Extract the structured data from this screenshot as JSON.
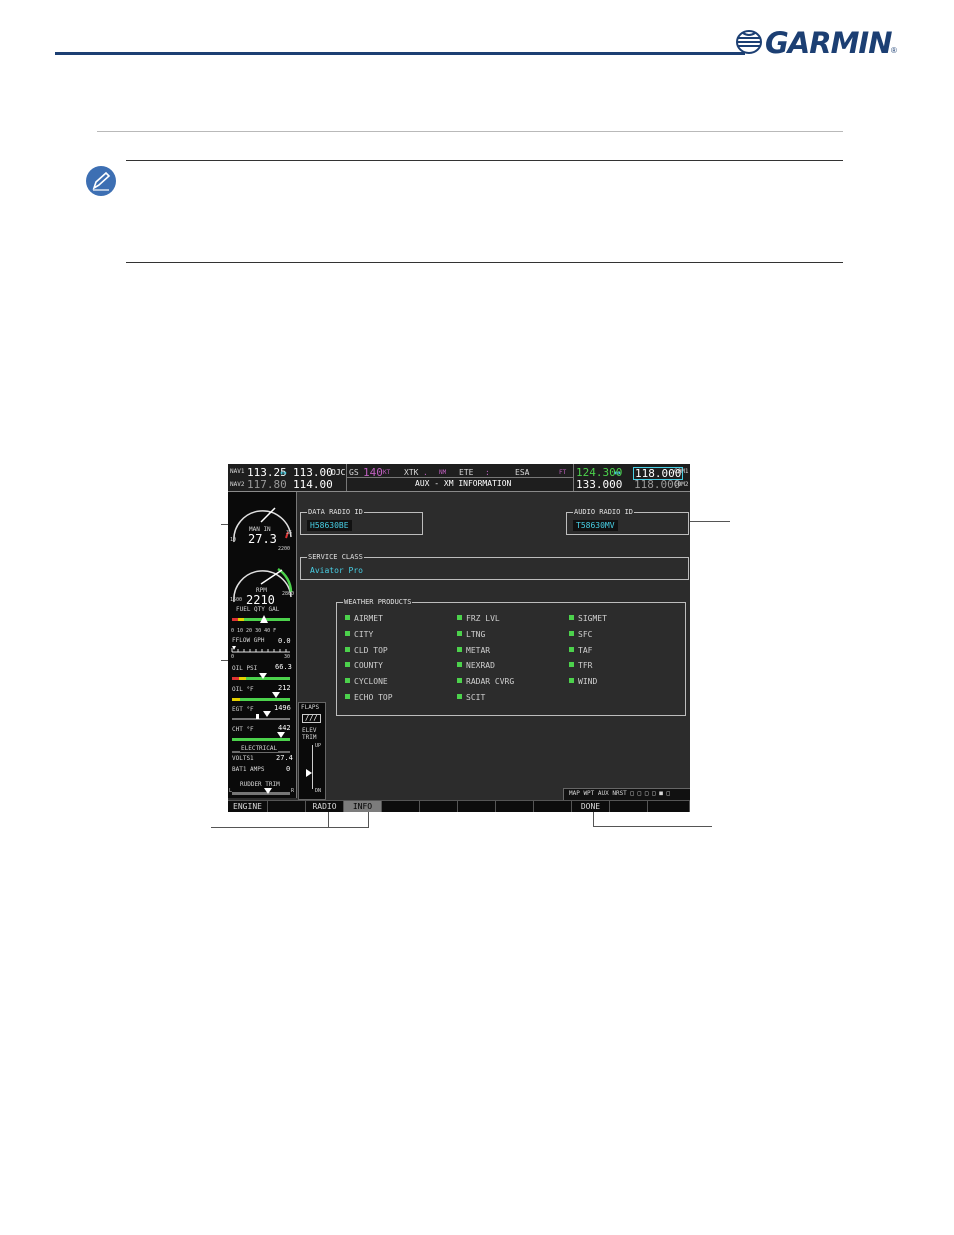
{
  "brand": {
    "name": "GARMIN",
    "reg": "®",
    "logo_icon": "globe-icon"
  },
  "note_icon": "pencil-note-icon",
  "screen": {
    "header": {
      "nav1_label": "NAV1",
      "nav1_active": "113.25",
      "nav1_swap": "↔",
      "nav1_standby": "113.00",
      "nav1_ident": "OJC",
      "nav2_label": "NAV2",
      "nav2_active": "117.80",
      "nav2_standby": "114.00",
      "gs_label": "GS",
      "gs_value": "140",
      "gs_unit": "KT",
      "xtk_label": "XTK",
      "xtk_value": ".",
      "xtk_unit": "NM",
      "ete_label": "ETE",
      "ete_value": ":",
      "esa_label": "ESA",
      "esa_unit": "FT",
      "page_title": "AUX - XM INFORMATION",
      "com1_active": "124.300",
      "com1_swap": "↔",
      "com1_standby": "118.000",
      "com1_label": "COM1",
      "com2_active": "133.000",
      "com2_standby": "118.000",
      "com2_label": "COM2"
    },
    "engine": {
      "man_in_label": "MAN IN",
      "man_in_value": "27.3",
      "man_min": "10",
      "man_max": "35",
      "rpm_label": "RPM",
      "rpm_value": "2210",
      "rpm_min": "1500",
      "rpm_max": "2800",
      "rpm_top": "2200",
      "fuel_qty_label": "FUEL QTY GAL",
      "fuel_scale": "0  10  20  30  40 F",
      "fflow_label": "FFLOW GPH",
      "fflow_value": "0.0",
      "fflow_min": "0",
      "fflow_max": "30",
      "oil_psi_label": "OIL PSI",
      "oil_psi_value": "66.3",
      "oil_f_label": "OIL °F",
      "oil_f_value": "212",
      "egt_label": "EGT °F",
      "egt_value": "1496",
      "cht_label": "CHT °F",
      "cht_value": "442",
      "electrical_label": "ELECTRICAL",
      "volts_label": "VOLTS1",
      "volts_value": "27.4",
      "amps_label": "BAT1 AMPS",
      "amps_value": "0",
      "rudder_trim_label": "RUDDER TRIM",
      "rudder_l": "L",
      "rudder_r": "R",
      "flaps_label": "FLAPS",
      "flaps_value": "///",
      "elev_label": "ELEV",
      "trim_label": "TRIM",
      "elev_up": "UP",
      "elev_dn": "DN"
    },
    "data_radio": {
      "label": "DATA RADIO ID",
      "value": "H58630BE"
    },
    "audio_radio": {
      "label": "AUDIO RADIO ID",
      "value": "T58630MV"
    },
    "service_class": {
      "label": "SERVICE CLASS",
      "value": "Aviator Pro"
    },
    "weather": {
      "label": "WEATHER PRODUCTS",
      "col1": [
        "AIRMET",
        "CITY",
        "CLD TOP",
        "COUNTY",
        "CYCLONE",
        "ECHO TOP"
      ],
      "col2": [
        "FRZ LVL",
        "LTNG",
        "METAR",
        "NEXRAD",
        "RADAR CVRG",
        "SCIT"
      ],
      "col3": [
        "SIGMET",
        "SFC",
        "TAF",
        "TFR",
        "WIND"
      ]
    },
    "page_group": "MAP WPT AUX NRST □ □ □ □ ■ □",
    "softkeys": [
      "ENGINE",
      "",
      "RADIO",
      "INFO",
      "",
      "",
      "",
      "",
      "",
      "DONE",
      "",
      ""
    ]
  },
  "colors": {
    "garmin_blue": "#1c3f73",
    "cyan": "#48d0e6",
    "green": "#4cd24c",
    "magenta": "#c060c0"
  }
}
